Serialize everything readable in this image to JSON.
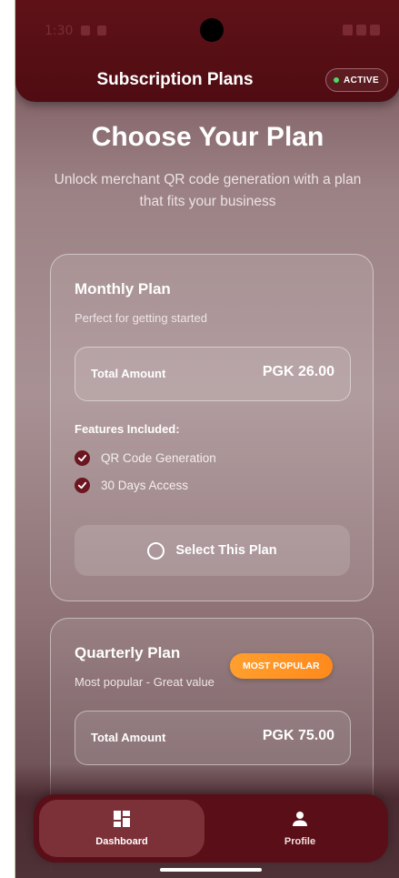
{
  "status_bar": {
    "time": "1:30"
  },
  "app_bar": {
    "title": "Subscription Plans",
    "status_badge": "ACTIVE"
  },
  "hero": {
    "title": "Choose Your Plan",
    "subtitle": "Unlock merchant QR code generation with a plan that fits your business"
  },
  "plans": [
    {
      "title": "Monthly Plan",
      "description": "Perfect for getting started",
      "total_label": "Total Amount",
      "total_value": "PGK 26.00",
      "features_title": "Features Included:",
      "features": [
        "QR Code Generation",
        "30 Days Access"
      ],
      "select_label": "Select This Plan"
    },
    {
      "title": "Quarterly Plan",
      "description": "Most popular - Great value",
      "badge": "MOST POPULAR",
      "total_label": "Total Amount",
      "total_value": "PGK 75.00"
    }
  ],
  "bottom_nav": {
    "items": [
      {
        "label": "Dashboard",
        "icon": "dashboard-icon",
        "selected": true
      },
      {
        "label": "Profile",
        "icon": "person-icon",
        "selected": false
      }
    ]
  },
  "colors": {
    "primary": "#5a0e17",
    "accent_badge": "#ff9f2d",
    "active_dot": "#4cd964"
  }
}
